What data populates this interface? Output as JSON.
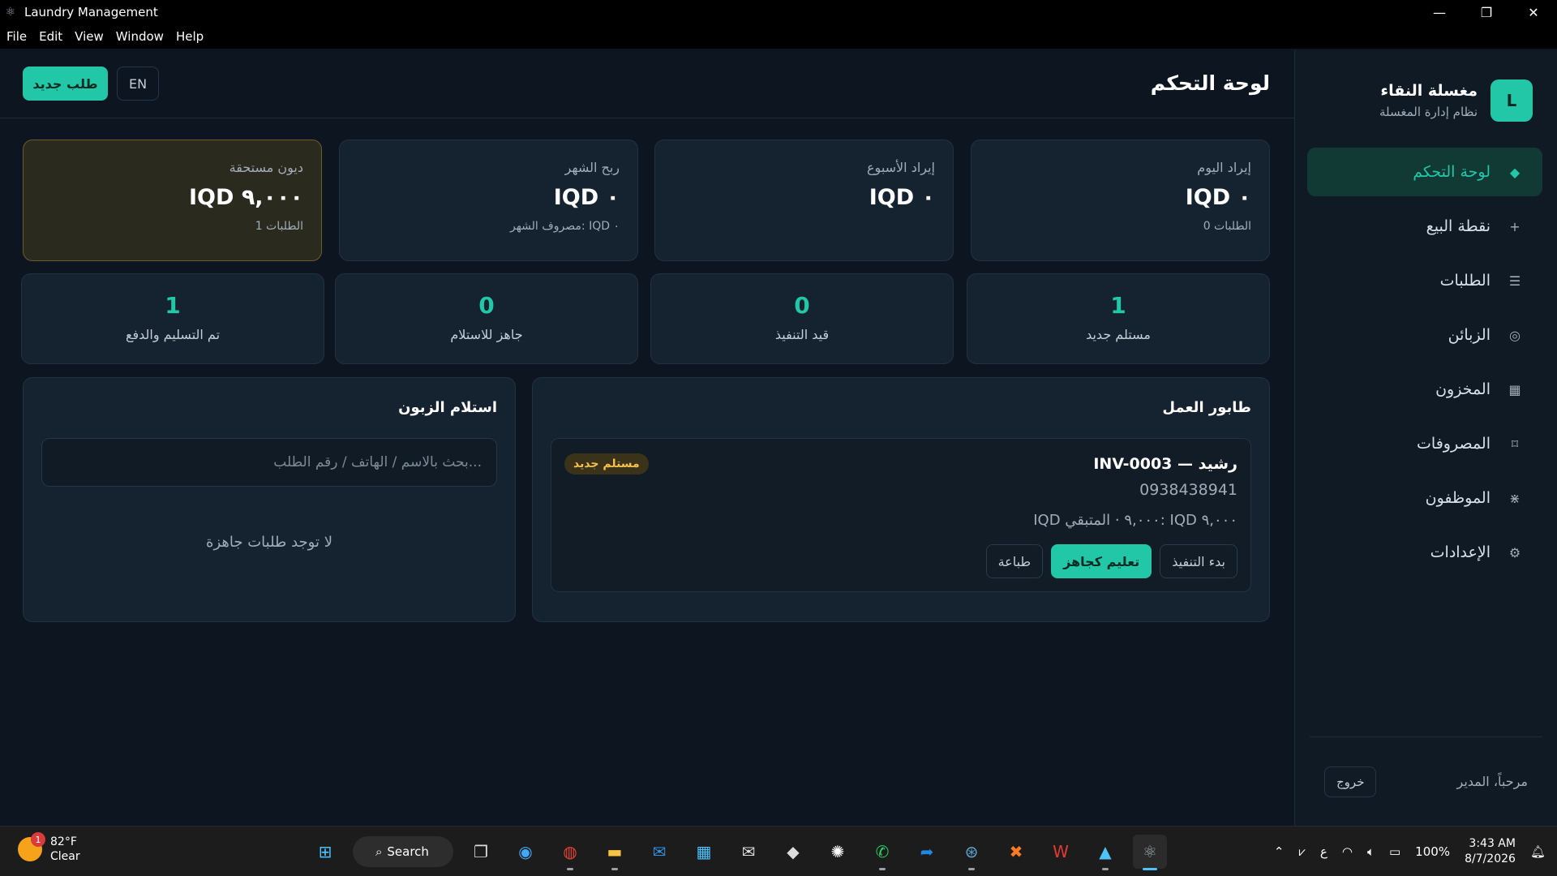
{
  "window": {
    "title": "Laundry Management",
    "menu": [
      "File",
      "Edit",
      "View",
      "Window",
      "Help"
    ]
  },
  "sidebar": {
    "brand_initial": "L",
    "brand_name": "مغسلة النقاء",
    "brand_subtitle": "نظام إدارة المغسلة",
    "items": [
      {
        "label": "لوحة التحكم",
        "icon": "◆"
      },
      {
        "label": "نقطة البيع",
        "icon": "+"
      },
      {
        "label": "الطلبات",
        "icon": "☰"
      },
      {
        "label": "الزبائن",
        "icon": "◎"
      },
      {
        "label": "المخزون",
        "icon": "▦"
      },
      {
        "label": "المصروفات",
        "icon": "⌑"
      },
      {
        "label": "الموظفون",
        "icon": "⋇"
      },
      {
        "label": "الإعدادات",
        "icon": "⚙"
      }
    ],
    "welcome": "مرحباً، المدير",
    "logout": "خروج"
  },
  "header": {
    "title": "لوحة التحكم",
    "new_order": "طلب جديد",
    "lang": "EN"
  },
  "stats": [
    {
      "label": "إيراد اليوم",
      "value": "IQD ٠",
      "sub": "0 الطلبات"
    },
    {
      "label": "إيراد الأسبوع",
      "value": "IQD ٠",
      "sub": ""
    },
    {
      "label": "ربح الشهر",
      "value": "IQD ٠",
      "sub": "مصروف الشهر: IQD ٠"
    },
    {
      "label": "ديون مستحقة",
      "value": "IQD ٩,٠٠٠",
      "sub": "1 الطلبات"
    }
  ],
  "counts": [
    {
      "value": "1",
      "label": "مستلم جديد"
    },
    {
      "value": "0",
      "label": "قيد التنفيذ"
    },
    {
      "value": "0",
      "label": "جاهز للاستلام"
    },
    {
      "value": "1",
      "label": "تم التسليم والدفع"
    }
  ],
  "queue": {
    "title": "طابور العمل",
    "order": {
      "heading": "INV-0003 — رشيد",
      "phone": "0938438941",
      "amount": "IQD ٩,٠٠٠ · المتبقي: IQD ٩,٠٠٠",
      "badge": "مستلم جديد",
      "actions": {
        "start": "بدء التنفيذ",
        "ready": "تعليم كجاهز",
        "print": "طباعة"
      }
    }
  },
  "pickup": {
    "title": "استلام الزبون",
    "search_placeholder": "بحث بالاسم / الهاتف / رقم الطلب...",
    "empty": "لا توجد طلبات جاهزة"
  },
  "taskbar": {
    "weather_temp": "82°F",
    "weather_desc": "Clear",
    "weather_badge": "1",
    "search": "Search",
    "lang_indicator": "ع",
    "battery": "100%",
    "time": "3:43 AM",
    "date": "8/7/2026"
  },
  "colors": {
    "accent": "#22c7a8",
    "background": "#0d1620",
    "card": "#152230",
    "badge_text": "#f2c14e"
  }
}
